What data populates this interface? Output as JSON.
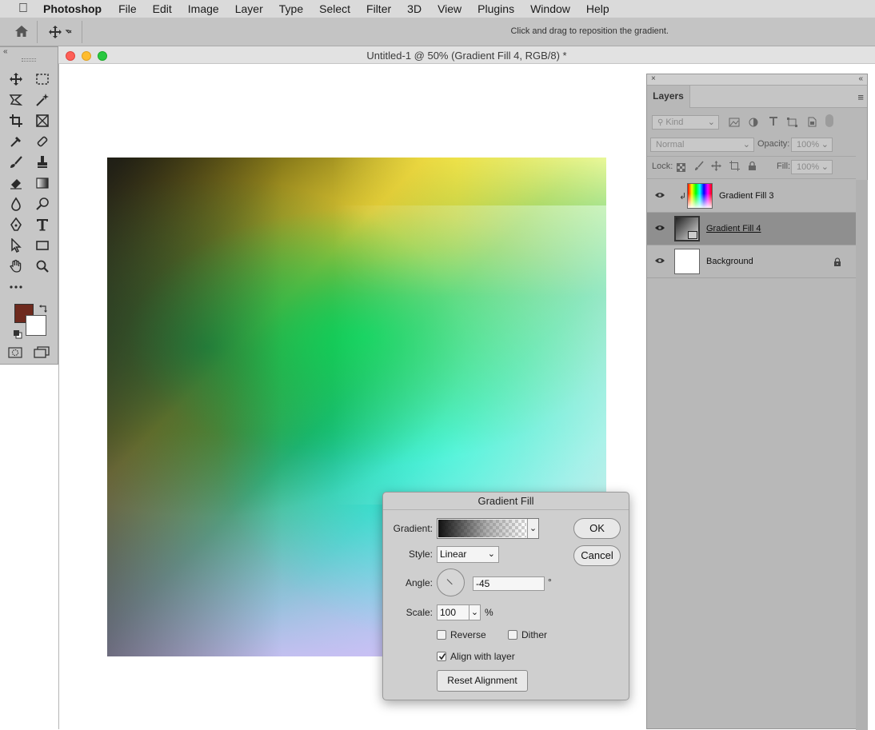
{
  "menubar": {
    "app_name": "Photoshop",
    "items": [
      "File",
      "Edit",
      "Image",
      "Layer",
      "Type",
      "Select",
      "Filter",
      "3D",
      "View",
      "Plugins",
      "Window",
      "Help"
    ]
  },
  "options_bar": {
    "hint": "Click and drag to reposition the gradient."
  },
  "document": {
    "title": "Untitled-1 @ 50% (Gradient Fill 4, RGB/8) *"
  },
  "tools": {
    "foreground_color": "#6e2a1e",
    "background_color": "#ffffff"
  },
  "layers_panel": {
    "tab": "Layers",
    "filter_kind": "Kind",
    "blend_mode": "Normal",
    "opacity_label": "Opacity:",
    "opacity_value": "100%",
    "lock_label": "Lock:",
    "fill_label": "Fill:",
    "fill_value": "100%",
    "layers": [
      {
        "name": "Gradient Fill 3",
        "selected": false
      },
      {
        "name": "Gradient Fill 4",
        "selected": true
      },
      {
        "name": "Background",
        "selected": false
      }
    ]
  },
  "dialog": {
    "title": "Gradient Fill",
    "gradient_label": "Gradient:",
    "style_label": "Style:",
    "style_value": "Linear",
    "angle_label": "Angle:",
    "angle_value": "-45",
    "angle_unit": "°",
    "scale_label": "Scale:",
    "scale_value": "100",
    "scale_unit": "%",
    "reverse_label": "Reverse",
    "reverse_checked": false,
    "dither_label": "Dither",
    "dither_checked": false,
    "align_label": "Align with layer",
    "align_checked": true,
    "reset_label": "Reset Alignment",
    "ok_label": "OK",
    "cancel_label": "Cancel"
  }
}
